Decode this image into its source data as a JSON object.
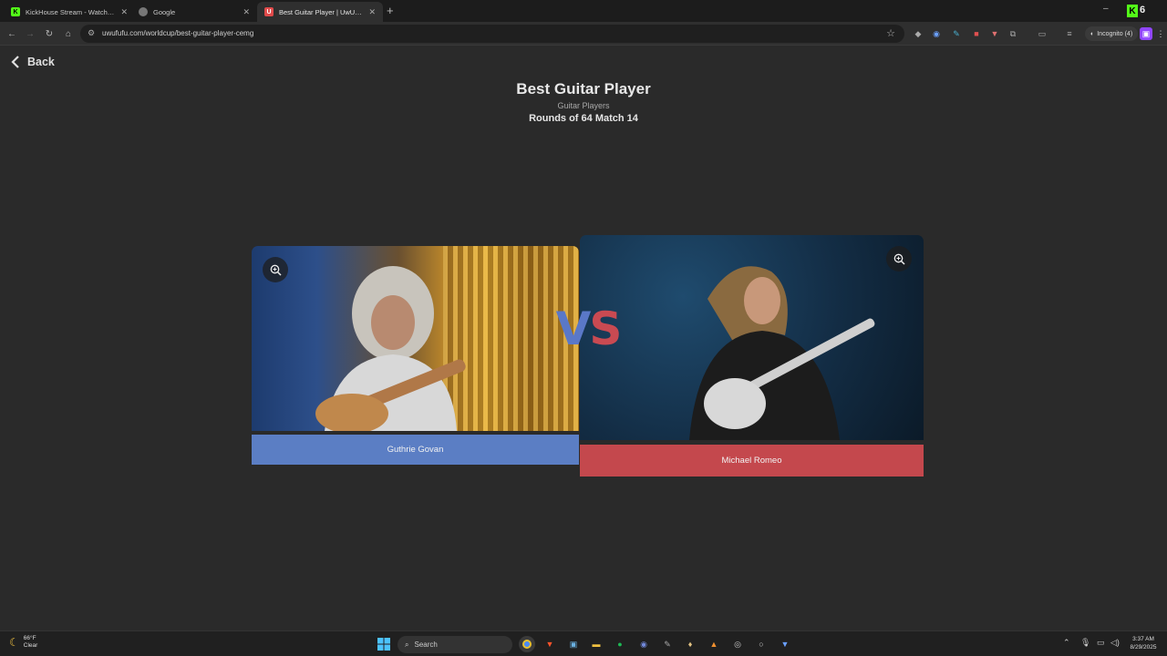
{
  "browser": {
    "tabs": [
      {
        "title": "KickHouse Stream - Watch Live",
        "favicon": "K",
        "favicon_color": "#53fc18"
      },
      {
        "title": "Google",
        "favicon": "",
        "favicon_color": "#888888"
      },
      {
        "title": "Best Guitar Player | UwUFUFU",
        "favicon": "U",
        "favicon_color": "#e04a4a"
      }
    ],
    "url": "uwufufu.com/worldcup/best-guitar-player-cemg",
    "incognito_label": "Incognito (4)"
  },
  "page": {
    "back_label": "Back",
    "title": "Best Guitar Player",
    "category": "Guitar Players",
    "round_info": "Rounds of 64 Match 14",
    "vs_v": "V",
    "vs_s": "S",
    "left_candidate": {
      "name": "Guthrie Govan",
      "color": "#5b7ec4"
    },
    "right_candidate": {
      "name": "Michael Romeo",
      "color": "#c4484d"
    }
  },
  "taskbar": {
    "weather_temp": "66°F",
    "weather_cond": "Clear",
    "search_label": "Search",
    "time": "3:37 AM",
    "date": "8/29/2025"
  }
}
